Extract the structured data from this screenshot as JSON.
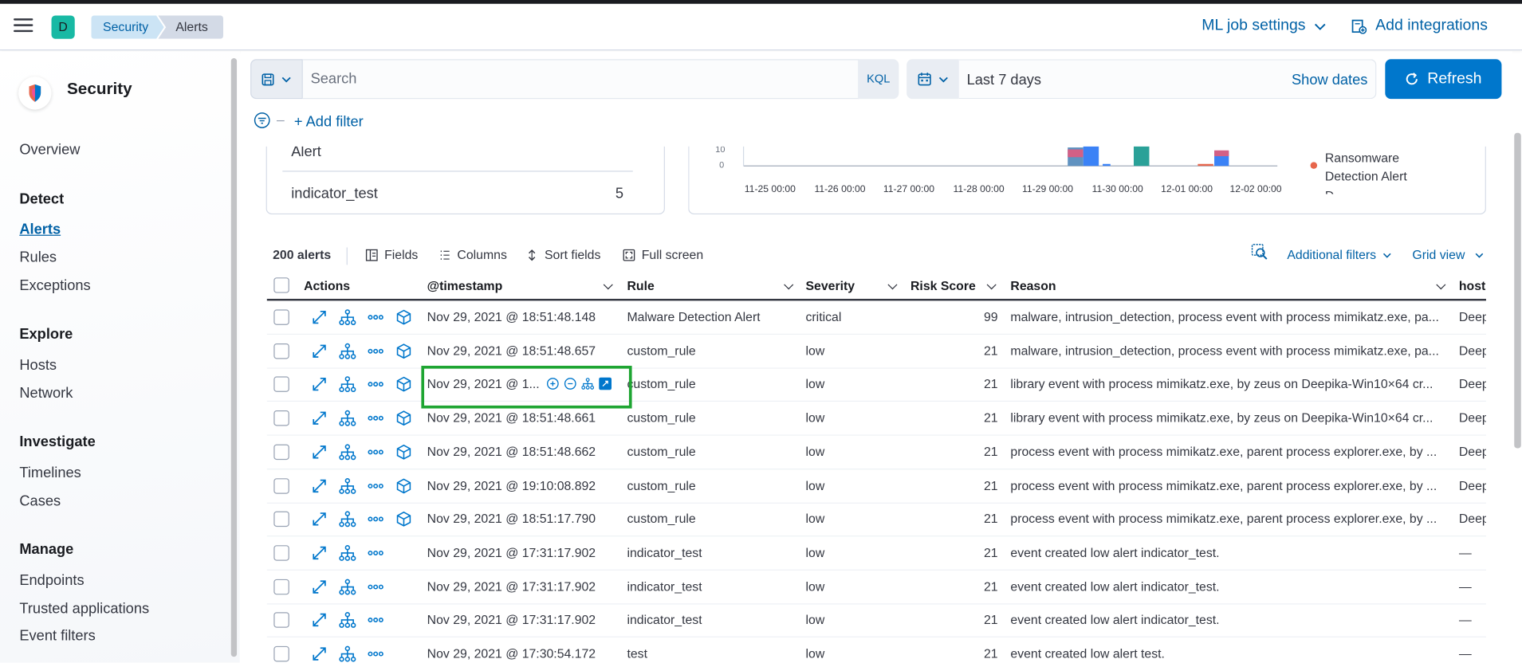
{
  "header": {
    "space_initial": "D",
    "breadcrumbs": [
      "Security",
      "Alerts"
    ],
    "ml_job_settings": "ML job settings",
    "add_integrations": "Add integrations"
  },
  "sidebar": {
    "title": "Security",
    "overview": "Overview",
    "sections": [
      {
        "title": "Detect",
        "items": [
          "Alerts",
          "Rules",
          "Exceptions"
        ]
      },
      {
        "title": "Explore",
        "items": [
          "Hosts",
          "Network"
        ]
      },
      {
        "title": "Investigate",
        "items": [
          "Timelines",
          "Cases"
        ]
      },
      {
        "title": "Manage",
        "items": [
          "Endpoints",
          "Trusted applications",
          "Event filters"
        ]
      }
    ],
    "active_item": "Alerts"
  },
  "query": {
    "search_placeholder": "Search",
    "kql_label": "KQL",
    "date_range": "Last 7 days",
    "show_dates": "Show dates",
    "refresh": "Refresh",
    "add_filter": "+ Add filter"
  },
  "summary_panel": {
    "partial_label": "Alert",
    "row_name": "indicator_test",
    "row_count": "5"
  },
  "histogram": {
    "y_ticks": [
      "10",
      "0"
    ],
    "x_ticks": [
      "11-25 00:00",
      "11-26 00:00",
      "11-27 00:00",
      "11-28 00:00",
      "11-29 00:00",
      "11-30 00:00",
      "12-01 00:00",
      "12-02 00:00"
    ],
    "legend_item": "Ransomware Detection Alert",
    "legend_color": "#e7664c",
    "legend_cut_text": "D"
  },
  "toolbar": {
    "alert_count": "200 alerts",
    "fields": "Fields",
    "columns": "Columns",
    "sort_fields": "Sort fields",
    "full_screen": "Full screen",
    "additional_filters": "Additional filters",
    "grid_view": "Grid view"
  },
  "table": {
    "headers": {
      "actions": "Actions",
      "timestamp": "@timestamp",
      "rule": "Rule",
      "severity": "Severity",
      "risk_score": "Risk Score",
      "reason": "Reason",
      "host": "host"
    },
    "rows": [
      {
        "timestamp": "Nov 29, 2021 @ 18:51:48.148",
        "rule": "Malware Detection Alert",
        "severity": "critical",
        "risk": "99",
        "reason": "malware, intrusion_detection, process event with process mimikatz.exe, pa...",
        "host": "Deep",
        "analyze": true
      },
      {
        "timestamp": "Nov 29, 2021 @ 18:51:48.657",
        "rule": "custom_rule",
        "severity": "low",
        "risk": "21",
        "reason": "malware, intrusion_detection, process event with process mimikatz.exe, pa...",
        "host": "Deep",
        "analyze": true
      },
      {
        "timestamp": "Nov 29, 2021 @ 1...",
        "rule": "custom_rule",
        "severity": "low",
        "risk": "21",
        "reason": "library event with process mimikatz.exe, by zeus on Deepika-Win10×64 cr...",
        "host": "Deep",
        "analyze": true
      },
      {
        "timestamp": "Nov 29, 2021 @ 18:51:48.661",
        "rule": "custom_rule",
        "severity": "low",
        "risk": "21",
        "reason": "library event with process mimikatz.exe, by zeus on Deepika-Win10×64 cr...",
        "host": "Deep",
        "analyze": true
      },
      {
        "timestamp": "Nov 29, 2021 @ 18:51:48.662",
        "rule": "custom_rule",
        "severity": "low",
        "risk": "21",
        "reason": "process event with process mimikatz.exe, parent process explorer.exe, by ...",
        "host": "Deep",
        "analyze": true
      },
      {
        "timestamp": "Nov 29, 2021 @ 19:10:08.892",
        "rule": "custom_rule",
        "severity": "low",
        "risk": "21",
        "reason": "process event with process mimikatz.exe, parent process explorer.exe, by ...",
        "host": "Deep",
        "analyze": true
      },
      {
        "timestamp": "Nov 29, 2021 @ 18:51:17.790",
        "rule": "custom_rule",
        "severity": "low",
        "risk": "21",
        "reason": "process event with process mimikatz.exe, parent process explorer.exe, by ...",
        "host": "Deep",
        "analyze": true
      },
      {
        "timestamp": "Nov 29, 2021 @ 17:31:17.902",
        "rule": "indicator_test",
        "severity": "low",
        "risk": "21",
        "reason": "event created low alert indicator_test.",
        "host": "—",
        "analyze": false
      },
      {
        "timestamp": "Nov 29, 2021 @ 17:31:17.902",
        "rule": "indicator_test",
        "severity": "low",
        "risk": "21",
        "reason": "event created low alert indicator_test.",
        "host": "—",
        "analyze": false
      },
      {
        "timestamp": "Nov 29, 2021 @ 17:31:17.902",
        "rule": "indicator_test",
        "severity": "low",
        "risk": "21",
        "reason": "event created low alert indicator_test.",
        "host": "—",
        "analyze": false
      },
      {
        "timestamp": "Nov 29, 2021 @ 17:30:54.172",
        "rule": "test",
        "severity": "low",
        "risk": "21",
        "reason": "event created low alert test.",
        "host": "—",
        "analyze": false
      }
    ]
  },
  "colors": {
    "accent": "#0077cc",
    "link": "#0061a6",
    "highlight_box": "#1ea532"
  }
}
